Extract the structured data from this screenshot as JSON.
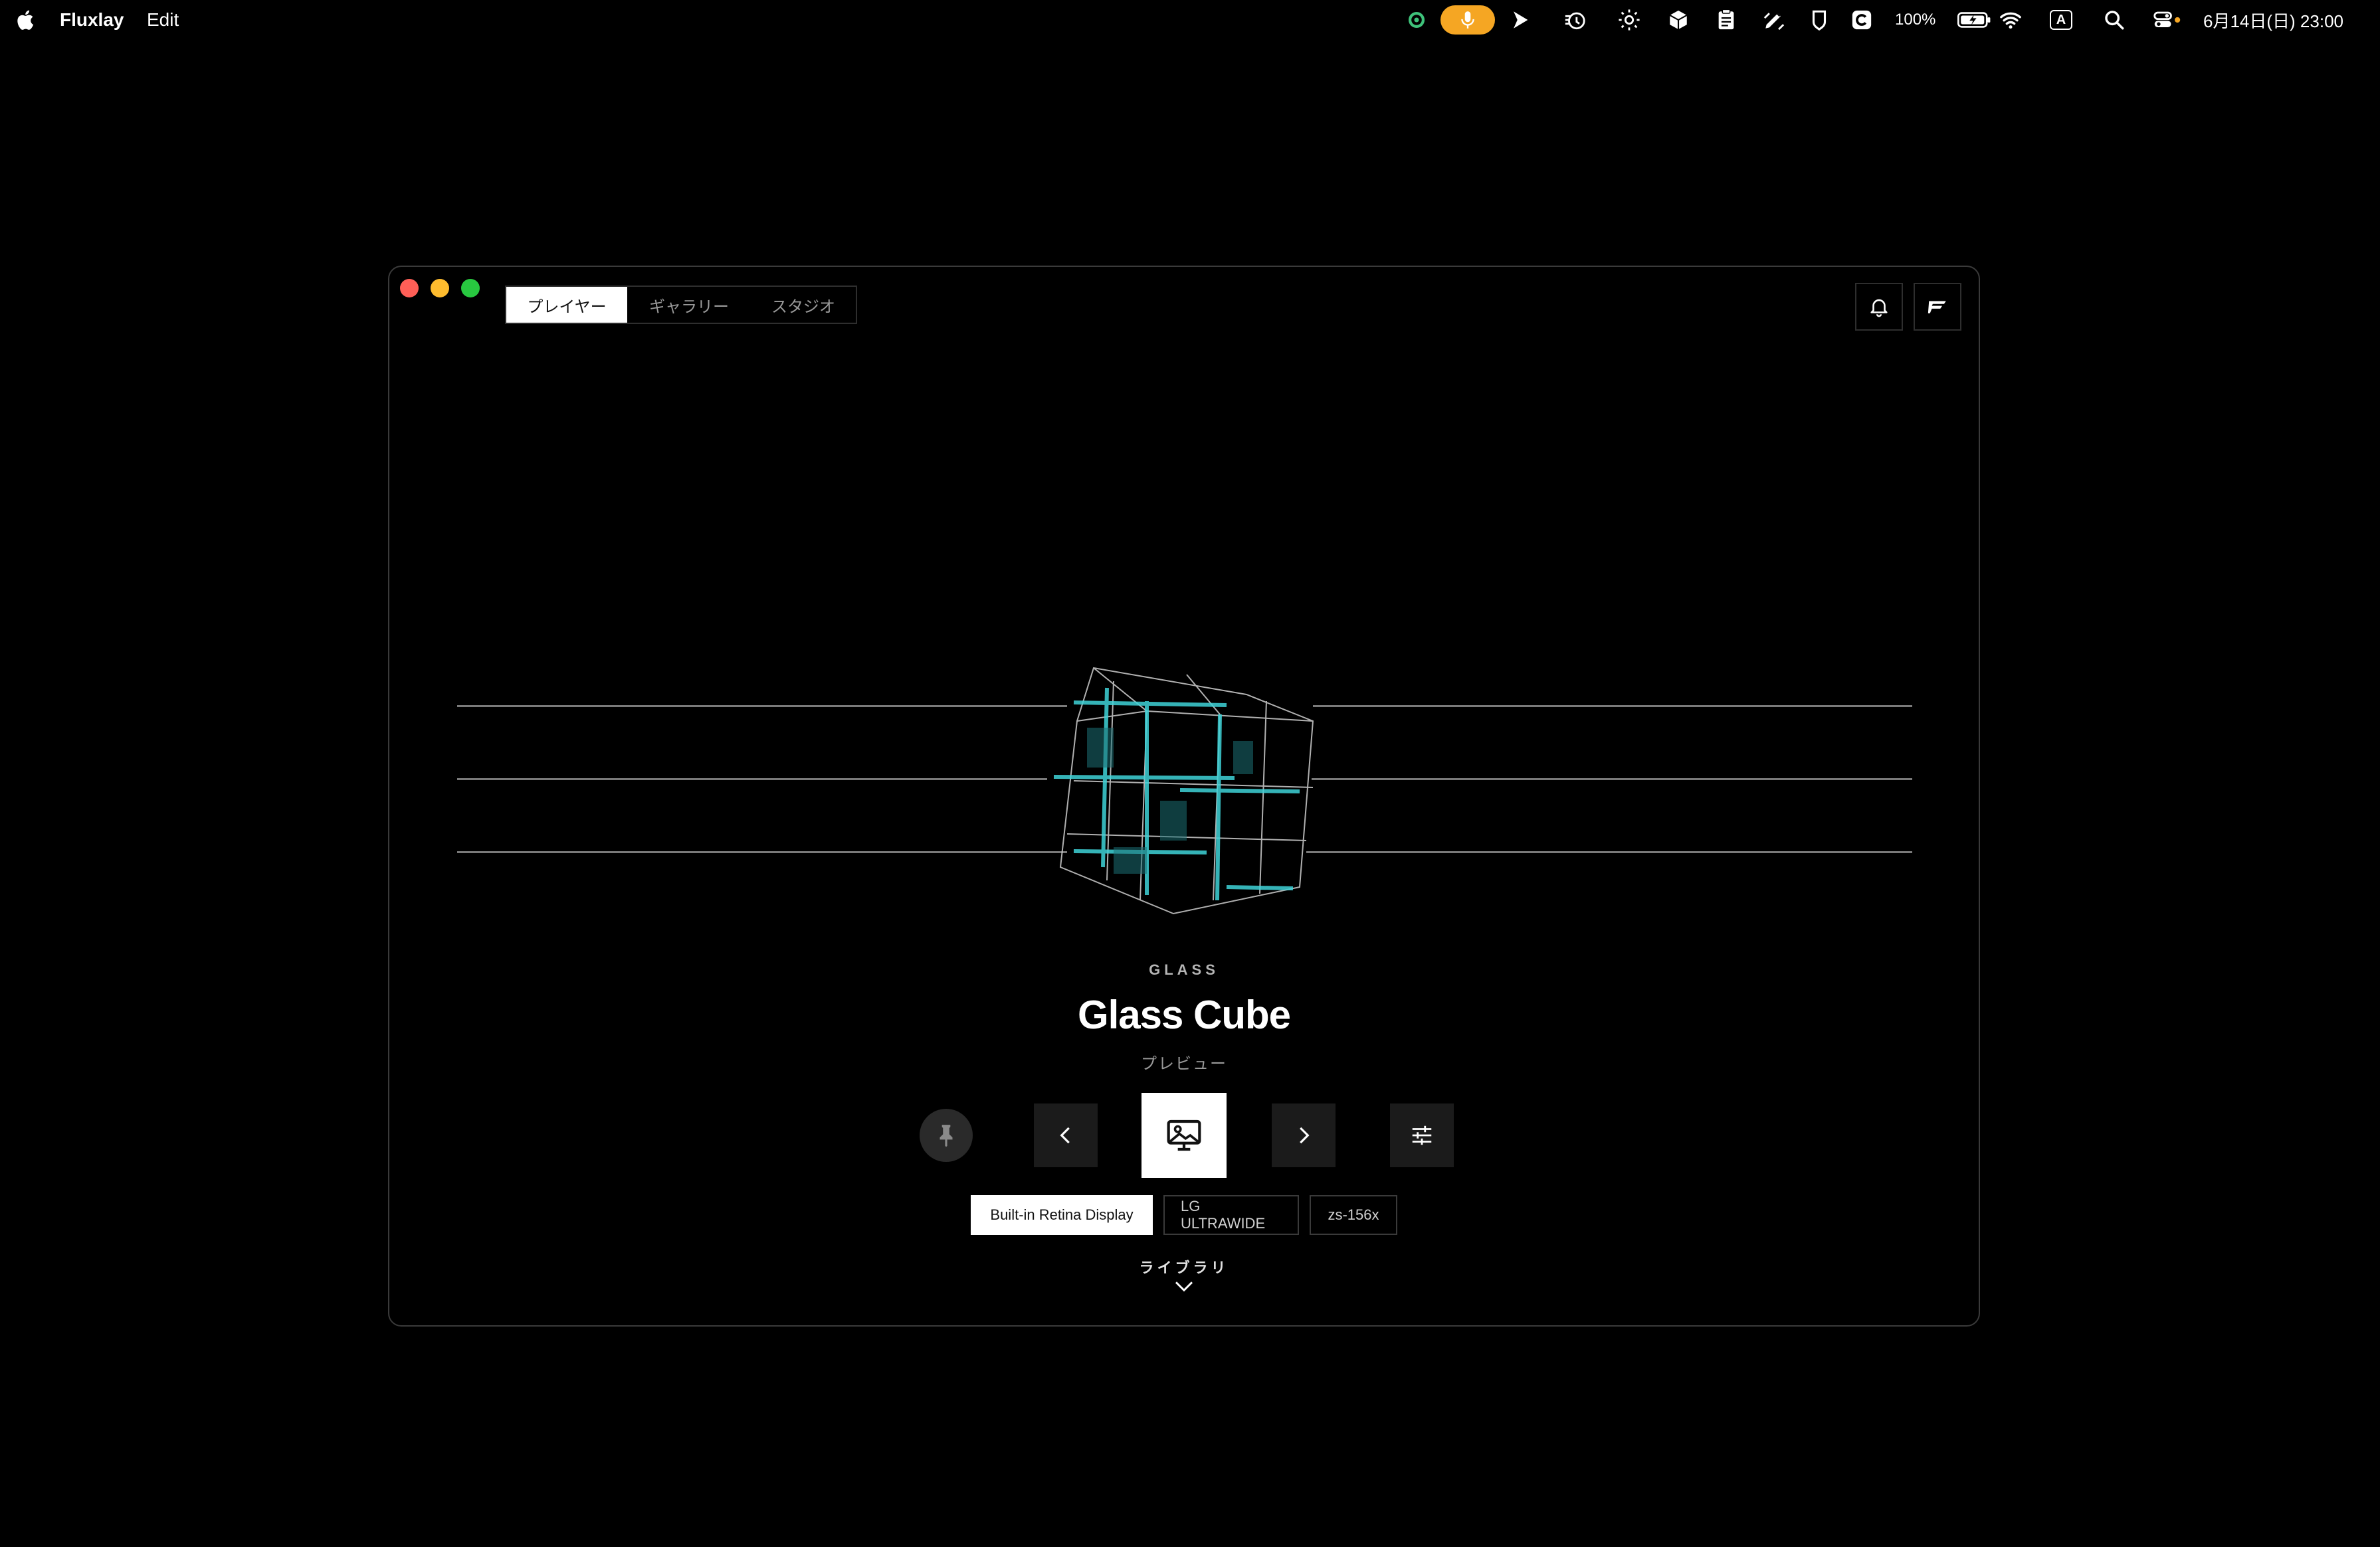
{
  "menubar": {
    "app_name": "Fluxlay",
    "menu_edit": "Edit",
    "battery_percent": "100%",
    "input_source": "A",
    "datetime": "6月14日(日)  23:00",
    "colors": {
      "mic_pill": "#f5a623"
    }
  },
  "window": {
    "tabs": [
      {
        "label": "プレイヤー",
        "active": true
      },
      {
        "label": "ギャラリー",
        "active": false
      },
      {
        "label": "スタジオ",
        "active": false
      }
    ],
    "top_buttons": {
      "bell": "bell-icon",
      "flag": "flag-icon"
    }
  },
  "preview": {
    "category": "GLASS",
    "title": "Glass Cube",
    "subtitle": "プレビュー",
    "accent_color": "#3fd3d8"
  },
  "controls": {
    "pin": "pin-icon",
    "prev": "chevron-left-icon",
    "set_wallpaper": "wallpaper-icon",
    "next": "chevron-right-icon",
    "adjust": "sliders-icon"
  },
  "displays": [
    {
      "label": "Built-in Retina Display",
      "active": true
    },
    {
      "label": "LG ULTRAWIDE",
      "active": false
    },
    {
      "label": "zs-156x",
      "active": false
    }
  ],
  "library": {
    "label": "ライブラリ"
  }
}
